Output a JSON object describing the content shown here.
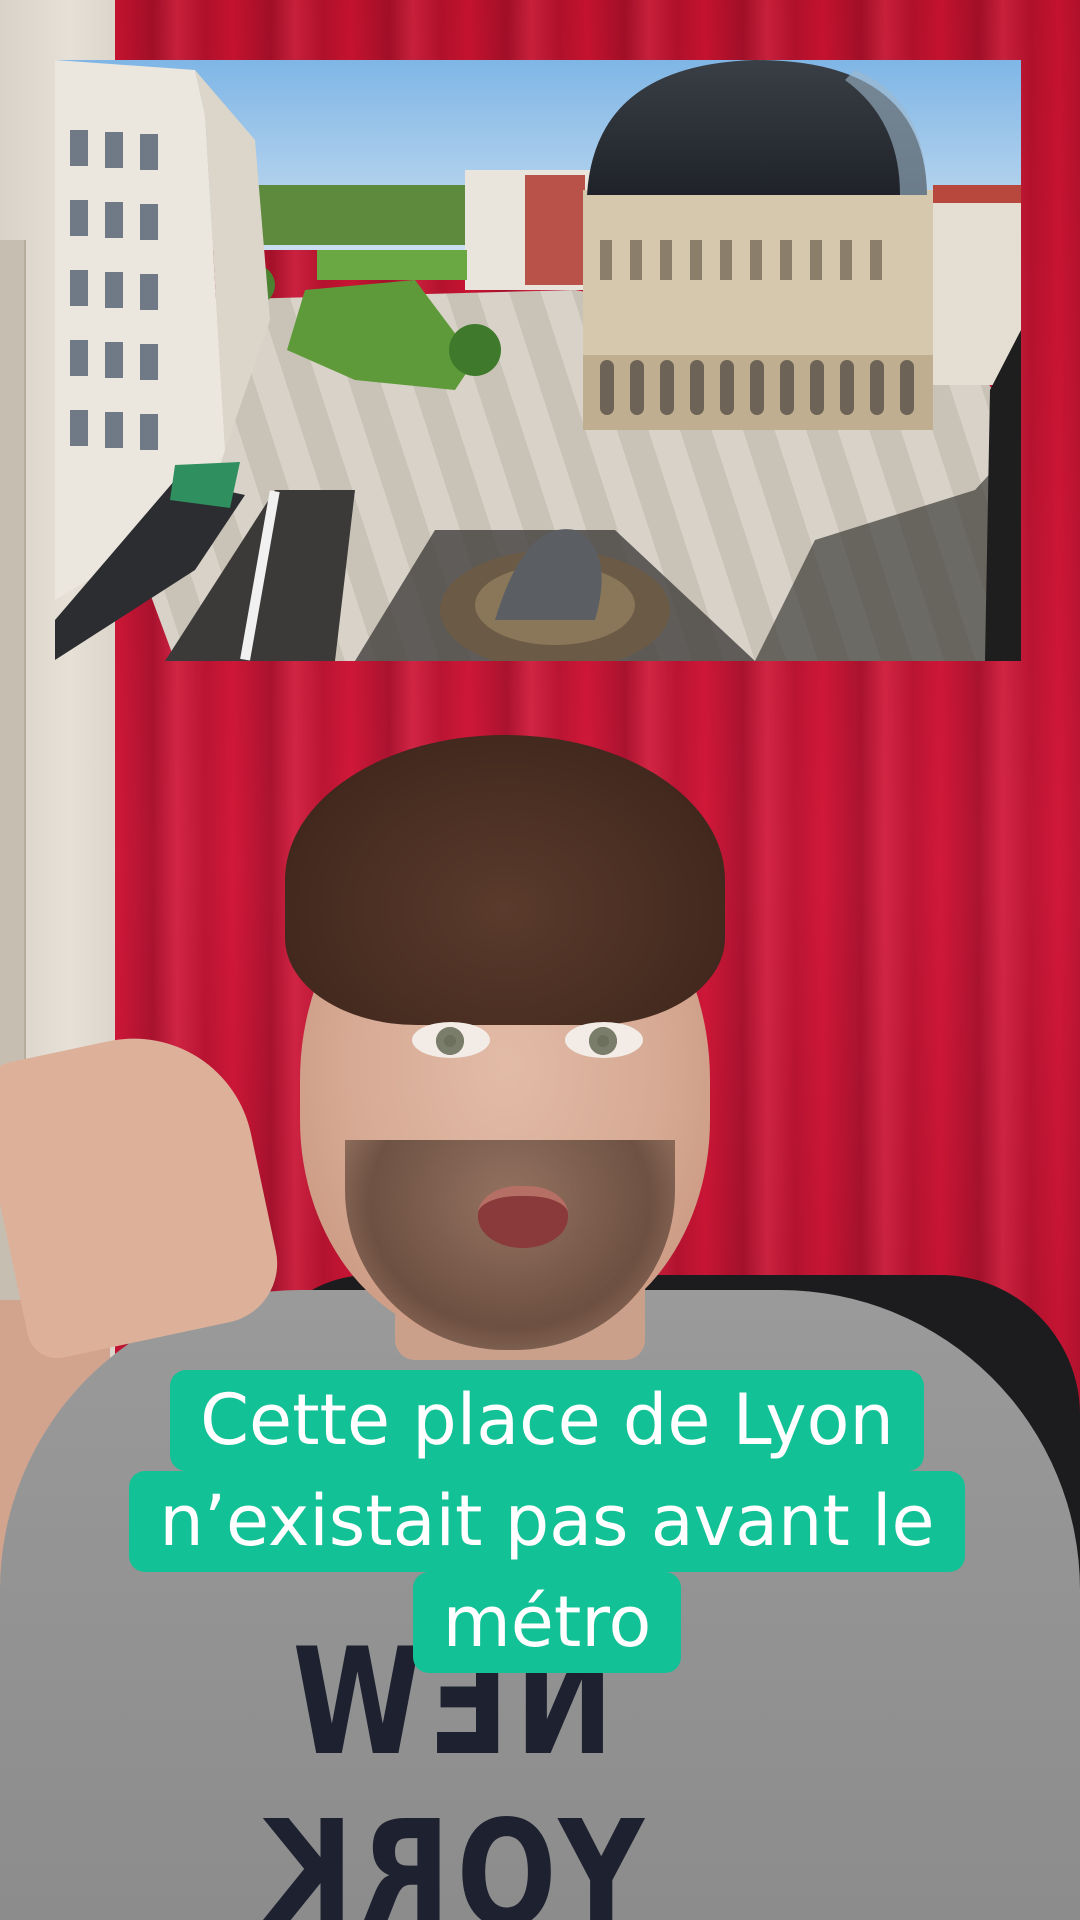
{
  "video": {
    "caption_lines": [
      "Cette place de Lyon",
      "n’existait pas avant le",
      "métro"
    ],
    "caption_bg_color": "#13c196",
    "caption_text_color": "#ffffff",
    "background_color": "#c3122f"
  },
  "inset_photo": {
    "subject": "aerial-view-of-square-and-opera-house"
  },
  "presenter": {
    "shirt_print": "NEW YORK"
  }
}
